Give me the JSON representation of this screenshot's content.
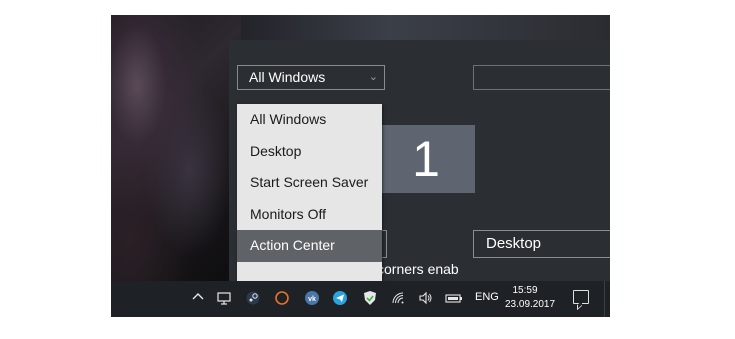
{
  "corner_action": {
    "selected_value": "All Windows",
    "bottom_right_value": "Desktop",
    "corners_label": "corners enab"
  },
  "monitor": {
    "number": "1"
  },
  "dropdown": {
    "options": [
      "All Windows",
      "Desktop",
      "Start Screen Saver",
      "Monitors Off",
      "Action Center"
    ],
    "highlighted": "Action Center"
  },
  "taskbar": {
    "language": "ENG",
    "time": "15:59",
    "date": "23.09.2017",
    "icons": [
      "chevron-up-icon",
      "display-icon",
      "steam-icon",
      "circle-app-icon",
      "vk-icon",
      "telegram-icon",
      "shield-check-icon",
      "wifi-icon",
      "volume-icon",
      "battery-icon",
      "notification-icon"
    ]
  },
  "colors": {
    "panel": "#2b2f34",
    "dropdown_bg": "#e6e6e6",
    "highlight": "#5f6368",
    "taskbar": "#1e2125",
    "monitor": "#5e6570"
  }
}
